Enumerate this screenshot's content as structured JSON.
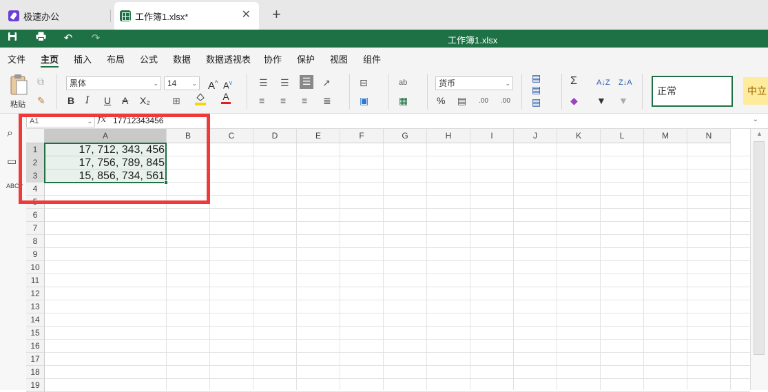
{
  "tabs": [
    {
      "label": "极速办公",
      "active": false
    },
    {
      "label": "工作簿1.xlsx*",
      "active": true
    }
  ],
  "window_title": "工作簿1.xlsx",
  "menu": [
    "文件",
    "主页",
    "插入",
    "布局",
    "公式",
    "数据",
    "数据透视表",
    "协作",
    "保护",
    "视图",
    "组件"
  ],
  "ribbon": {
    "paste_label": "粘贴",
    "font_name": "黑体",
    "font_size": "14",
    "number_format": "货币",
    "cell_style_normal": "正常",
    "cell_style_neutral": "中立",
    "bold": "B",
    "italic": "I",
    "underline": "U",
    "strike": "A",
    "subscript": "X₂",
    "increase_font": "A",
    "decrease_font": "A",
    "font_color": "A",
    "percent": "%",
    "sum": "Σ",
    "dec_increase": ".00",
    "dec_decrease": ".00"
  },
  "formula_bar": {
    "name_box": "A1",
    "fx": "fx",
    "value": "17712343456"
  },
  "columns": [
    "A",
    "B",
    "C",
    "D",
    "E",
    "F",
    "G",
    "H",
    "I",
    "J",
    "K",
    "L",
    "M",
    "N"
  ],
  "selected_column": "A",
  "rows": [
    "1",
    "2",
    "3",
    "4",
    "5",
    "6",
    "7",
    "8",
    "9",
    "10",
    "11",
    "12",
    "13",
    "14",
    "15",
    "16",
    "17",
    "18",
    "19"
  ],
  "selected_rows": [
    "1",
    "2",
    "3"
  ],
  "cells": {
    "A1": "17, 712, 343, 456",
    "A2": "17, 756, 789, 845",
    "A3": "15, 856, 734, 561"
  },
  "colors": {
    "accent": "#1e7145",
    "highlight": "#ef3a3a",
    "fill_swatch": "#f5d800",
    "font_swatch": "#e02020"
  }
}
